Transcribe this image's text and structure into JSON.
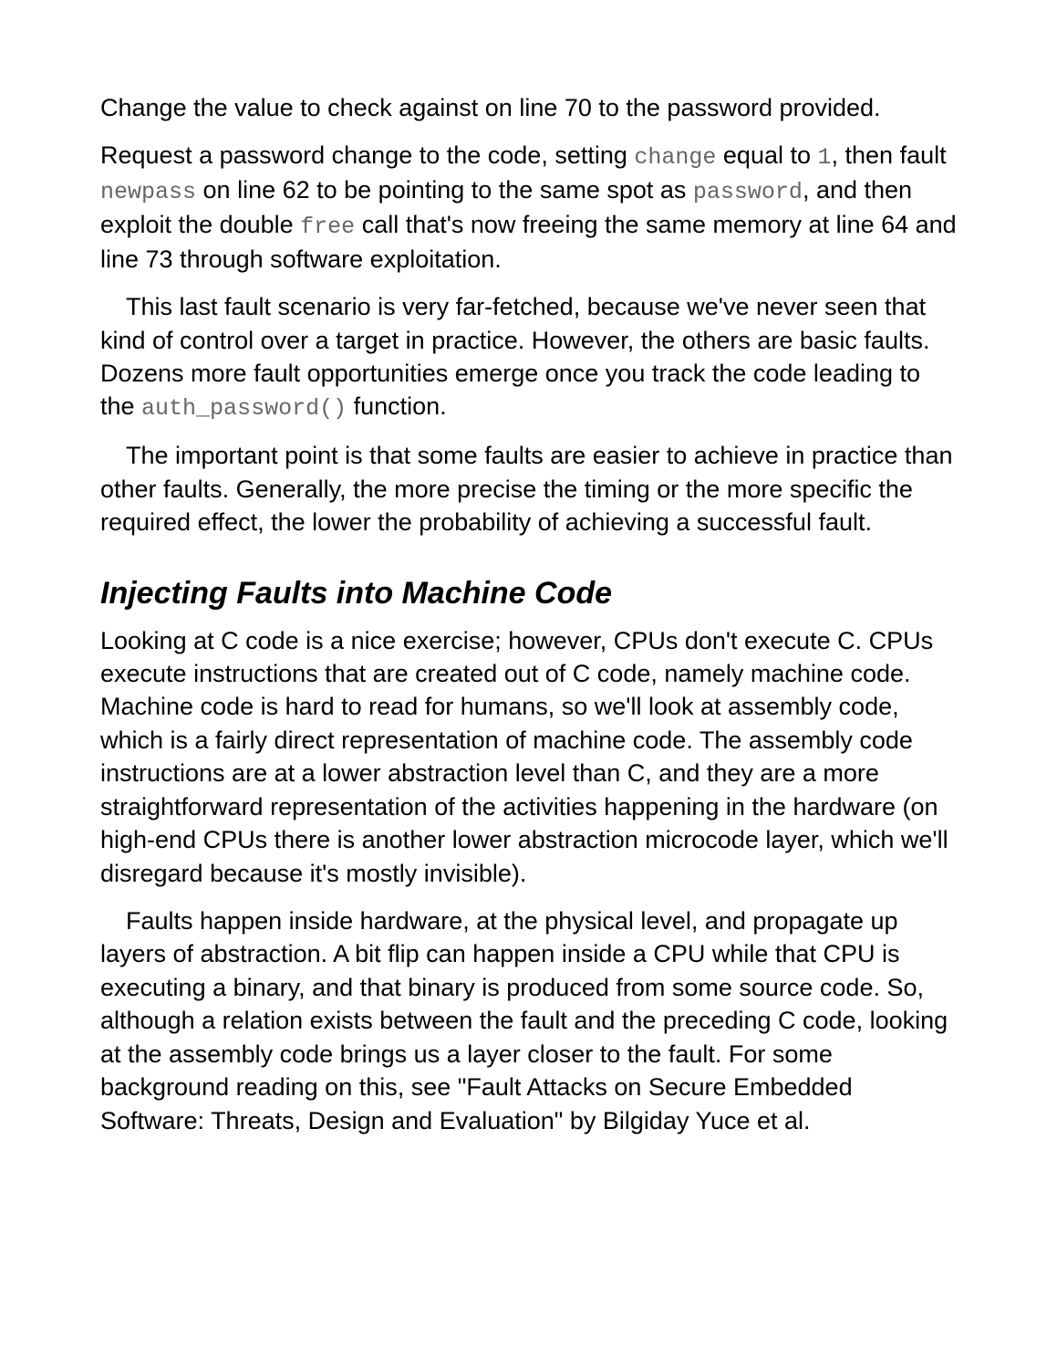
{
  "paragraphs": {
    "p1": "Change the value to check against on line 70 to the password provided.",
    "p2_a": "Request a password change to the code, setting ",
    "p2_code1": "change",
    "p2_b": " equal to ",
    "p2_code2": "1",
    "p2_c": ", then fault ",
    "p2_code3": "newpass",
    "p2_d": " on line 62 to be pointing to the same spot as ",
    "p2_code4": "password",
    "p2_e": ", and then exploit the double ",
    "p2_code5": "free",
    "p2_f": " call that's now freeing the same memory at line 64 and line 73 through software exploitation.",
    "p3_a": "This last fault scenario is very far-fetched, because we've never seen that kind of control over a target in practice. However, the others are basic faults. Dozens more fault opportunities emerge once you track the code leading to the ",
    "p3_code1": "auth_password()",
    "p3_b": " function.",
    "p4": "The important point is that some faults are easier to achieve in practice than other faults. Generally, the more precise the timing or the more specific the required effect, the lower the probability of achieving a successful fault."
  },
  "heading": "Injecting Faults into Machine Code",
  "section": {
    "s1": "Looking at C code is a nice exercise; however, CPUs don't execute C. CPUs execute instructions that are created out of C code, namely machine code. Machine code is hard to read for humans, so we'll look at assembly code, which is a fairly direct representation of machine code. The assembly code instructions are at a lower abstraction level than C, and they are a more straightforward representation of the activities happening in the hardware (on high-end CPUs there is another lower abstraction microcode layer, which we'll disregard because it's mostly invisible).",
    "s2": "Faults happen inside hardware, at the physical level, and propagate up layers of abstraction. A bit flip can happen inside a CPU while that CPU is executing a binary, and that binary is produced from some source code. So, although a relation exists between the fault and the preceding C code, looking at the assembly code brings us a layer closer to the fault. For some background reading on this, see \"Fault Attacks on Secure Embedded Software: Threats, Design and Evaluation\" by Bilgiday Yuce et al."
  }
}
